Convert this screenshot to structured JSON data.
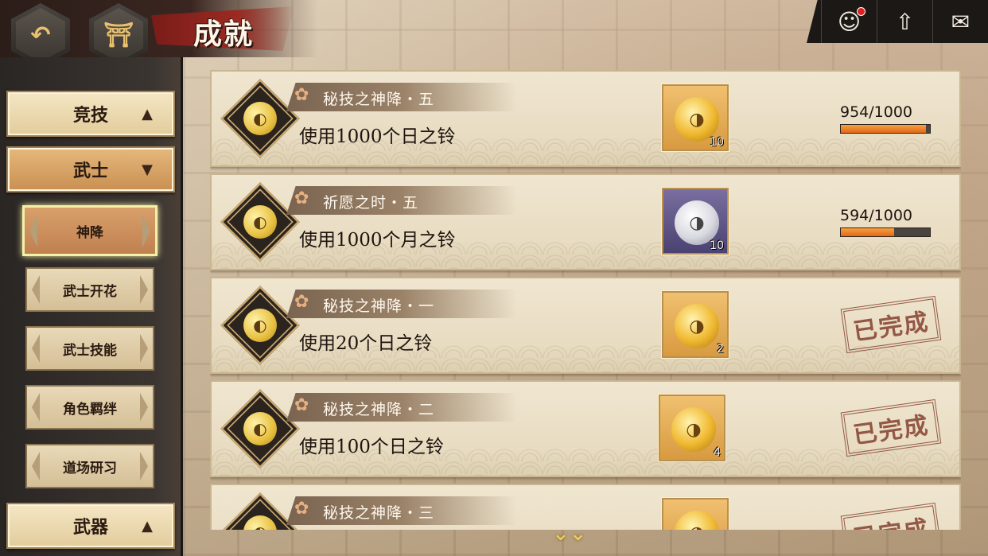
{
  "header": {
    "title": "成就",
    "back_icon": "↶",
    "home_icon": "⛩"
  },
  "toolbar": {
    "profile_icon": "☺",
    "upgrade_icon": "⇧",
    "mail_icon": "✉"
  },
  "sidebar": {
    "categories": [
      {
        "label": "竞技",
        "arrow": "▲"
      },
      {
        "label": "武士",
        "arrow": "▼"
      },
      {
        "label": "武器",
        "arrow": "▲"
      }
    ],
    "sub_items": [
      "神降",
      "武士开花",
      "武士技能",
      "角色羁绊",
      "道场研习"
    ]
  },
  "achievements": [
    {
      "title": "秘技之神降・五",
      "description": "使用1000个日之铃",
      "reward_qty": "10",
      "reward_type": "sun-bell",
      "progress": "954/1000",
      "progress_fraction": 0.954,
      "completed": false
    },
    {
      "title": "祈愿之时・五",
      "description": "使用1000个月之铃",
      "reward_qty": "10",
      "reward_type": "moon-bell",
      "progress": "594/1000",
      "progress_fraction": 0.594,
      "completed": false
    },
    {
      "title": "秘技之神降・一",
      "description": "使用20个日之铃",
      "reward_qty": "2",
      "reward_type": "sun-bell",
      "completed": true,
      "stamp": "已完成"
    },
    {
      "title": "秘技之神降・二",
      "description": "使用100个日之铃",
      "reward_qty": "4",
      "reward_type": "sun-bell",
      "completed": true,
      "stamp": "已完成"
    },
    {
      "title": "秘技之神降・三",
      "reward_type": "sun-bell",
      "completed": true,
      "stamp": "已完成"
    }
  ],
  "scroll_hint_icon": "⌄⌄",
  "colors": {
    "progress_fill": "#e06818",
    "stamp": "#8a4a38",
    "active_sub_glow": "#f4f0a8"
  }
}
